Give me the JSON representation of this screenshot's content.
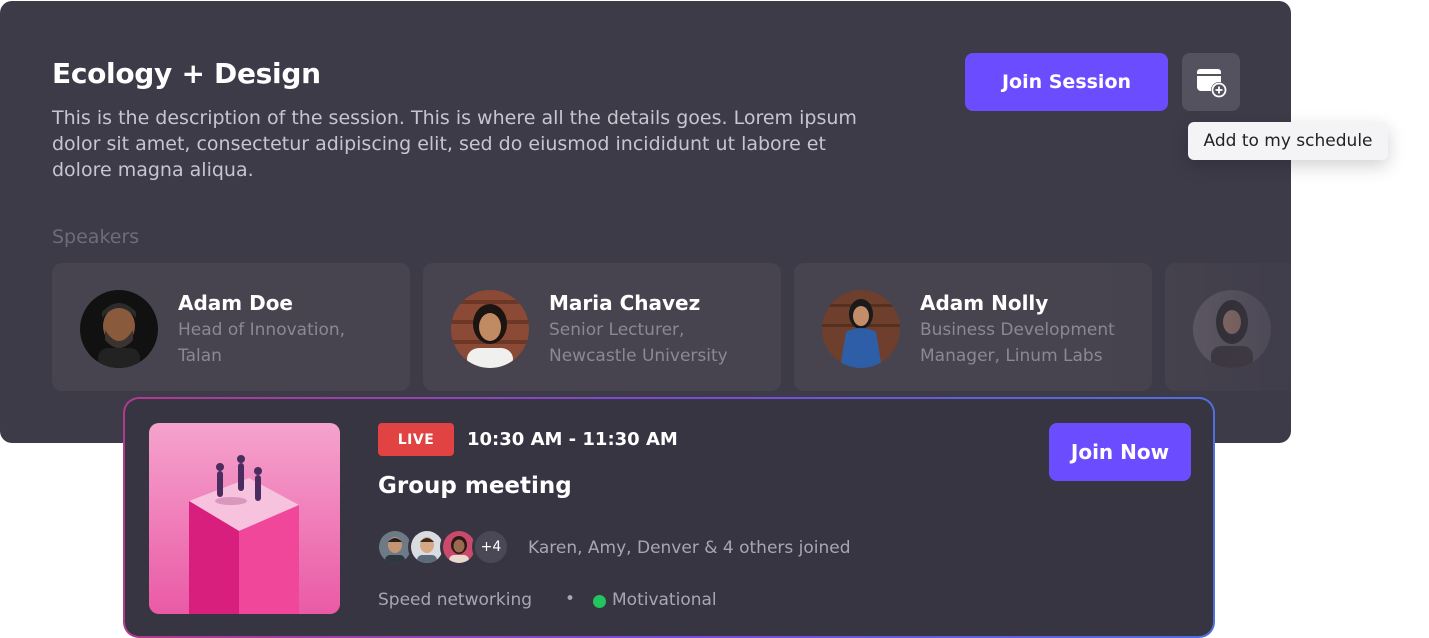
{
  "session": {
    "title": "Ecology + Design",
    "description": "This is the description of the session. This is where all the details goes. Lorem ipsum dolor sit amet, consectetur adipiscing elit, sed do eiusmod incididunt ut labore et dolore magna aliqua.",
    "join_label": "Join Session",
    "schedule_icon": "calendar-add-icon",
    "tooltip": "Add to my schedule",
    "speakers_label": "Speakers",
    "speakers": [
      {
        "name": "Adam Doe",
        "role_line1": "Head of Innovation,",
        "role_line2": "Talan"
      },
      {
        "name": "Maria Chavez",
        "role_line1": "Senior Lecturer,",
        "role_line2": "Newcastle University"
      },
      {
        "name": "Adam Nolly",
        "role_line1": "Business Development",
        "role_line2": "Manager, Linum Labs"
      }
    ]
  },
  "meeting": {
    "live_label": "LIVE",
    "time": "10:30 AM - 11:30 AM",
    "title": "Group meeting",
    "join_label": "Join Now",
    "more_count": "+4",
    "joined_text": "Karen, Amy, Denver & 4 others joined",
    "tag1": "Speed networking",
    "separator": "•",
    "tag2": "Motivational"
  },
  "colors": {
    "accent": "#6b4dff",
    "card_bg": "#3e3b49",
    "live": "#e14343",
    "status_green": "#22c55e"
  }
}
